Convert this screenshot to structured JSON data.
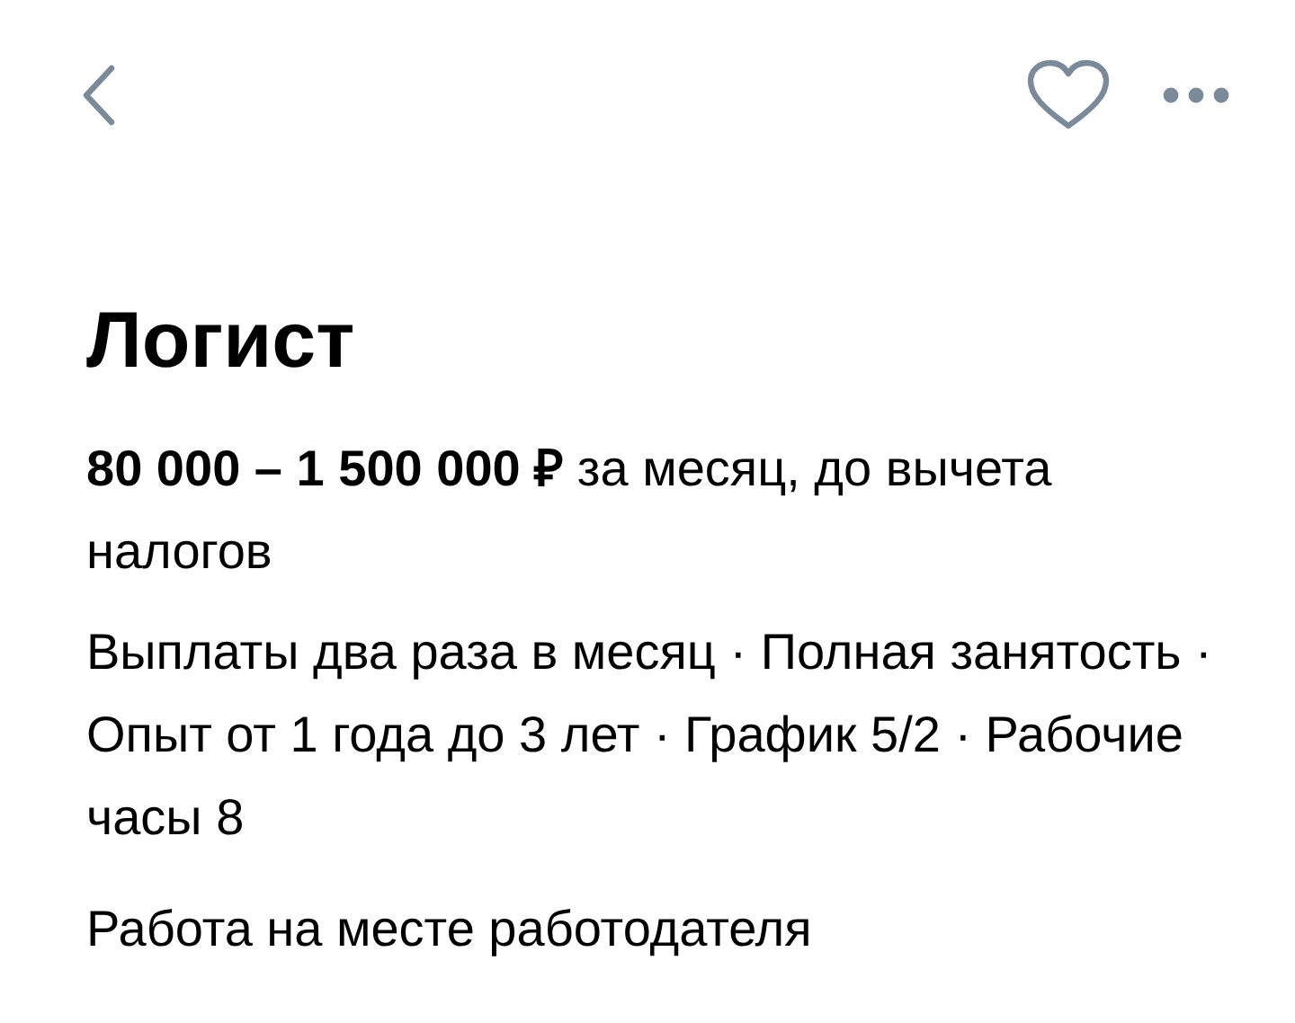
{
  "header": {
    "liked": false
  },
  "title": "Логист",
  "salary": "**80 000 – 1 500 000 ₽** за месяц, до вычета налогов",
  "details": "Выплаты два раза в месяц · Полная занятость · Опыт от 1 года до 3 лет · График 5/2 · Рабочие часы 8",
  "workplace": "Работа на месте работодателя"
}
